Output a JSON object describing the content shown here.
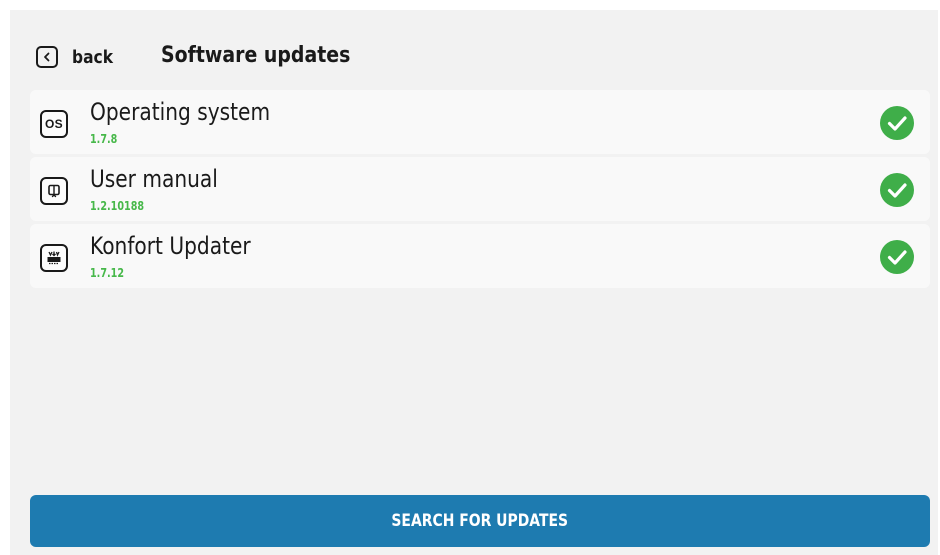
{
  "header": {
    "back_label": "back",
    "title": "Software updates"
  },
  "updates": [
    {
      "name": "Operating system",
      "version": "1.7.8",
      "icon": "os-icon",
      "icon_text": "OS",
      "status": "check-icon"
    },
    {
      "name": "User manual",
      "version": "1.2.10188",
      "icon": "book-icon",
      "status": "check-icon"
    },
    {
      "name": "Konfort Updater",
      "version": "1.7.12",
      "icon": "updater-icon",
      "status": "check-icon"
    }
  ],
  "actions": {
    "search_label": "SEARCH FOR UPDATES"
  },
  "colors": {
    "accent": "#1e7bb0",
    "success": "#3fae49",
    "version_text": "#47b84a",
    "background": "#f2f2f2"
  }
}
